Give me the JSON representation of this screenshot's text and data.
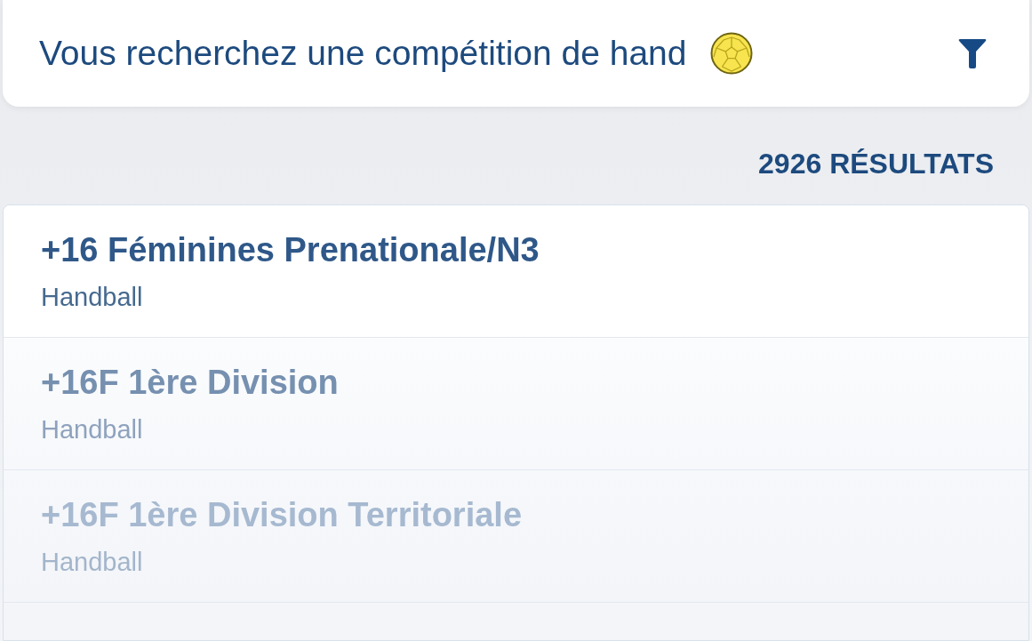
{
  "search": {
    "text": "Vous recherchez une compétition de hand"
  },
  "results_count": "2926 RÉSULTATS",
  "results": [
    {
      "title": "+16 Féminines Prenationale/N3",
      "sport": "Handball"
    },
    {
      "title": "+16F 1ère Division",
      "sport": "Handball"
    },
    {
      "title": "+16F 1ère Division Territoriale",
      "sport": "Handball"
    }
  ]
}
